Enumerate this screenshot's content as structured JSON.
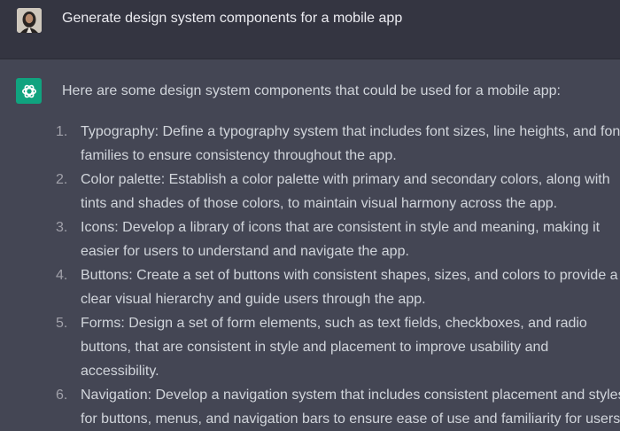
{
  "user_message": {
    "text": "Generate design system components for a mobile app",
    "avatar": "user-avatar"
  },
  "assistant_message": {
    "avatar": "openai-logo-icon",
    "intro": "Here are some design system components that could be used for a mobile app:",
    "items": [
      {
        "number": "1.",
        "lines": [
          "Typography: Define a typography system that includes font sizes, line heights, and font",
          "families to ensure consistency throughout the app."
        ]
      },
      {
        "number": "2.",
        "lines": [
          "Color palette: Establish a color palette with primary and secondary colors, along with",
          "tints and shades of those colors, to maintain visual harmony across the app."
        ]
      },
      {
        "number": "3.",
        "lines": [
          "Icons: Develop a library of icons that are consistent in style and meaning, making it",
          "easier for users to understand and navigate the app."
        ]
      },
      {
        "number": "4.",
        "lines": [
          "Buttons: Create a set of buttons with consistent shapes, sizes, and colors to provide a",
          "clear visual hierarchy and guide users through the app."
        ]
      },
      {
        "number": "5.",
        "lines": [
          "Forms: Design a set of form elements, such as text fields, checkboxes, and radio",
          "buttons, that are consistent in style and placement to improve usability and",
          "accessibility."
        ]
      },
      {
        "number": "6.",
        "lines": [
          "Navigation: Develop a navigation system that includes consistent placement and styles",
          "for buttons, menus, and navigation bars to ensure ease of use and familiarity for users."
        ]
      }
    ]
  }
}
